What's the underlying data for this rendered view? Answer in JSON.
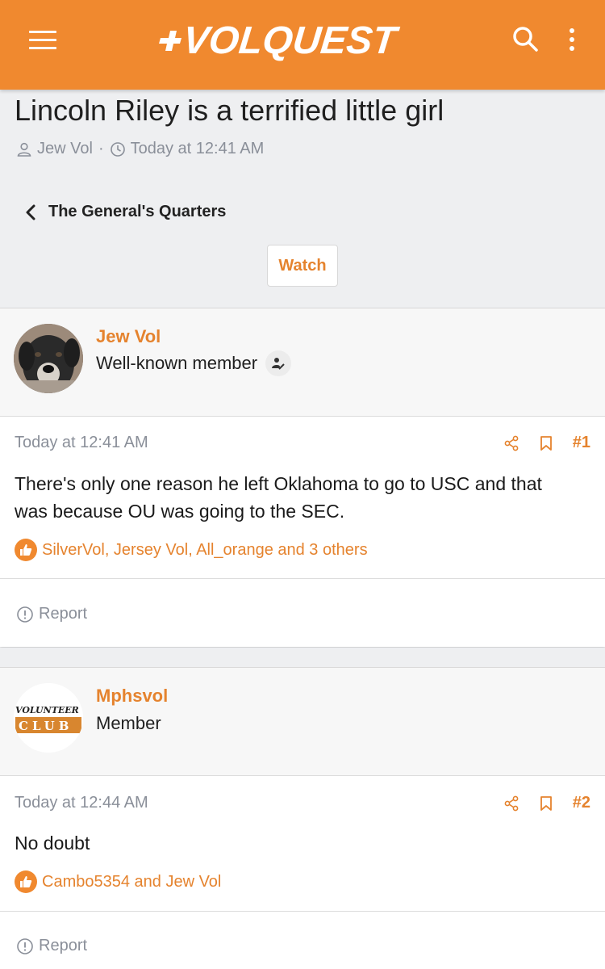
{
  "header": {
    "logo_text": "VOLQUEST",
    "accent_color": "#f0892f"
  },
  "thread": {
    "title": "Lincoln Riley is a terrified little girl",
    "author": "Jew Vol",
    "meta_sep": "·",
    "time": "Today at 12:41 AM"
  },
  "breadcrumb": {
    "label": "The General's Quarters"
  },
  "watch_label": "Watch",
  "posts": [
    {
      "username": "Jew Vol",
      "user_title": "Well-known member",
      "date": "Today at 12:41 AM",
      "number": "#1",
      "body": "There's only one reason he left Oklahoma to go to USC and that was because OU was going to the SEC.",
      "likes": "SilverVol, Jersey Vol, All_orange and 3 others",
      "report_label": "Report"
    },
    {
      "username": "Mphsvol",
      "user_title": "Member",
      "avatar_text_top": "VOLUNTEER",
      "avatar_text_bottom": "CLUB",
      "date": "Today at 12:44 AM",
      "number": "#2",
      "body": "No doubt",
      "likes": "Cambo5354 and Jew Vol",
      "report_label": "Report"
    }
  ]
}
